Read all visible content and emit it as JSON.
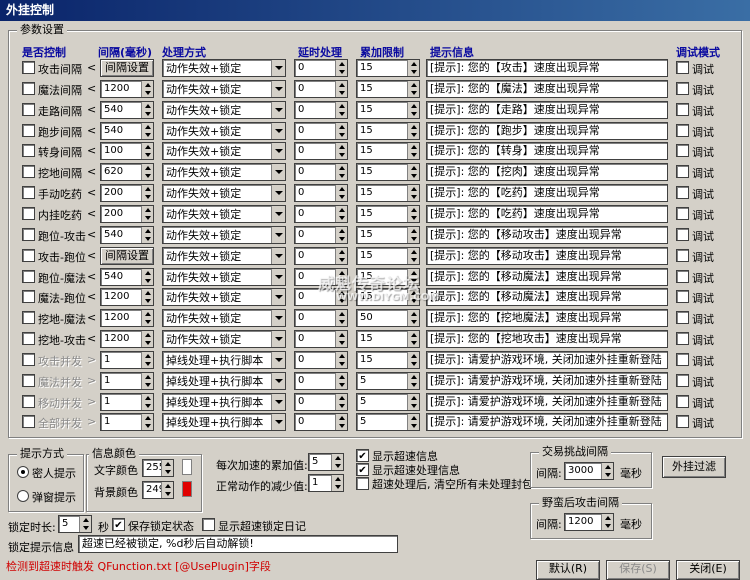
{
  "window": {
    "title": "外挂控制"
  },
  "params_group": {
    "title": "参数设置"
  },
  "headers": {
    "enabled": "是否控制",
    "interval": "间隔(毫秒)",
    "handling": "处理方式",
    "delay": "延时处理",
    "accumulate": "累加限制",
    "tip": "提示信息",
    "debug": "调试模式"
  },
  "rows": [
    {
      "label": "攻击间隔",
      "interval": "间隔设置",
      "interval_is_button": true,
      "handling": "动作失效+锁定",
      "delay": "0",
      "limit": "15",
      "tip": "[提示]: 您的【攻击】速度出现异常",
      "debug": "调试",
      "disabled": false
    },
    {
      "label": "魔法间隔",
      "interval": "1200",
      "handling": "动作失效+锁定",
      "delay": "0",
      "limit": "15",
      "tip": "[提示]: 您的【魔法】速度出现异常",
      "debug": "调试",
      "disabled": false
    },
    {
      "label": "走路间隔",
      "interval": "540",
      "handling": "动作失效+锁定",
      "delay": "0",
      "limit": "15",
      "tip": "[提示]: 您的【走路】速度出现异常",
      "debug": "调试",
      "disabled": false
    },
    {
      "label": "跑步间隔",
      "interval": "540",
      "handling": "动作失效+锁定",
      "delay": "0",
      "limit": "15",
      "tip": "[提示]: 您的【跑步】速度出现异常",
      "debug": "调试",
      "disabled": false
    },
    {
      "label": "转身间隔",
      "interval": "100",
      "handling": "动作失效+锁定",
      "delay": "0",
      "limit": "15",
      "tip": "[提示]: 您的【转身】速度出现异常",
      "debug": "调试",
      "disabled": false
    },
    {
      "label": "挖地间隔",
      "interval": "620",
      "handling": "动作失效+锁定",
      "delay": "0",
      "limit": "15",
      "tip": "[提示]: 您的【挖肉】速度出现异常",
      "debug": "调试",
      "disabled": false
    },
    {
      "label": "手动吃药",
      "interval": "200",
      "handling": "动作失效+锁定",
      "delay": "0",
      "limit": "15",
      "tip": "[提示]: 您的【吃药】速度出现异常",
      "debug": "调试",
      "disabled": false
    },
    {
      "label": "内挂吃药",
      "interval": "200",
      "handling": "动作失效+锁定",
      "delay": "0",
      "limit": "15",
      "tip": "[提示]: 您的【吃药】速度出现异常",
      "debug": "调试",
      "disabled": false
    },
    {
      "label": "跑位-攻击",
      "interval": "540",
      "handling": "动作失效+锁定",
      "delay": "0",
      "limit": "15",
      "tip": "[提示]: 您的【移动攻击】速度出现异常",
      "debug": "调试",
      "disabled": false
    },
    {
      "label": "攻击-跑位",
      "interval": "间隔设置",
      "interval_is_button": true,
      "handling": "动作失效+锁定",
      "delay": "0",
      "limit": "15",
      "tip": "[提示]: 您的【移动攻击】速度出现异常",
      "debug": "调试",
      "disabled": false
    },
    {
      "label": "跑位-魔法",
      "interval": "540",
      "handling": "动作失效+锁定",
      "delay": "0",
      "limit": "15",
      "tip": "[提示]: 您的【移动魔法】速度出现异常",
      "debug": "调试",
      "disabled": false
    },
    {
      "label": "魔法-跑位",
      "interval": "1200",
      "handling": "动作失效+锁定",
      "delay": "0",
      "limit": "15",
      "tip": "[提示]: 您的【移动魔法】速度出现异常",
      "debug": "调试",
      "disabled": false
    },
    {
      "label": "挖地-魔法",
      "interval": "1200",
      "handling": "动作失效+锁定",
      "delay": "0",
      "limit": "50",
      "tip": "[提示]: 您的【挖地魔法】速度出现异常",
      "debug": "调试",
      "disabled": false
    },
    {
      "label": "挖地-攻击",
      "interval": "1200",
      "handling": "动作失效+锁定",
      "delay": "0",
      "limit": "15",
      "tip": "[提示]: 您的【挖地攻击】速度出现异常",
      "debug": "调试",
      "disabled": false
    },
    {
      "label": "攻击并发",
      "interval": "1",
      "handling": "掉线处理+执行脚本",
      "delay": "0",
      "limit": "15",
      "tip": "[提示]: 请爱护游戏环境, 关闭加速外挂重新登陆",
      "debug": "调试",
      "disabled": true
    },
    {
      "label": "魔法并发",
      "interval": "1",
      "handling": "掉线处理+执行脚本",
      "delay": "0",
      "limit": "5",
      "tip": "[提示]: 请爱护游戏环境, 关闭加速外挂重新登陆",
      "debug": "调试",
      "disabled": true
    },
    {
      "label": "移动并发",
      "interval": "1",
      "handling": "掉线处理+执行脚本",
      "delay": "0",
      "limit": "5",
      "tip": "[提示]: 请爱护游戏环境, 关闭加速外挂重新登陆",
      "debug": "调试",
      "disabled": true
    },
    {
      "label": "全部并发",
      "interval": "1",
      "handling": "掉线处理+执行脚本",
      "delay": "0",
      "limit": "5",
      "tip": "[提示]: 请爱护游戏环境, 关闭加速外挂重新登陆",
      "debug": "调试",
      "disabled": true
    }
  ],
  "prompt_mode": {
    "title": "提示方式",
    "option_popup": "密人提示",
    "option_dialog": "弹窗提示",
    "selected": "密人提示"
  },
  "info_color": {
    "title": "信息颜色",
    "text_color_label": "文字颜色",
    "text_color_value": "255",
    "text_color_swatch": "#ffffff",
    "bg_color_label": "背景颜色",
    "bg_color_value": "249",
    "bg_color_swatch": "#e00000"
  },
  "accel": {
    "add_label": "每次加速的累加值:",
    "add_value": "5",
    "reduce_label": "正常动作的减少值:",
    "reduce_value": "1",
    "show_accel_info": "显示超速信息",
    "show_accel_handling": "显示超速处理信息",
    "clear_after": "超速处理后, 清空所有未处理封包"
  },
  "trade": {
    "title": "交易挑战间隔",
    "interval_label": "间隔:",
    "interval_value": "3000",
    "unit": "毫秒"
  },
  "wild": {
    "title": "野蛮后攻击间隔",
    "interval_label": "间隔:",
    "interval_value": "1200",
    "unit": "毫秒"
  },
  "filter_button": "外挂过滤",
  "lock": {
    "duration_label": "锁定时长:",
    "duration_value": "5",
    "unit": "秒",
    "save_state": "保存锁定状态",
    "show_log": "显示超速锁定日记",
    "tip_label": "锁定提示信息",
    "tip_value": "超速已经被锁定, %d秒后自动解锁!"
  },
  "footer_note": "检测到超速时触发 QFunction.txt [@UsePlugin]字段",
  "buttons": {
    "default": "默认(R)",
    "save": "保存(S)",
    "close": "关闭(E)"
  },
  "watermark": {
    "line1": "威魁传奇论坛",
    "line2": "WWW.DIYGM.COM"
  }
}
